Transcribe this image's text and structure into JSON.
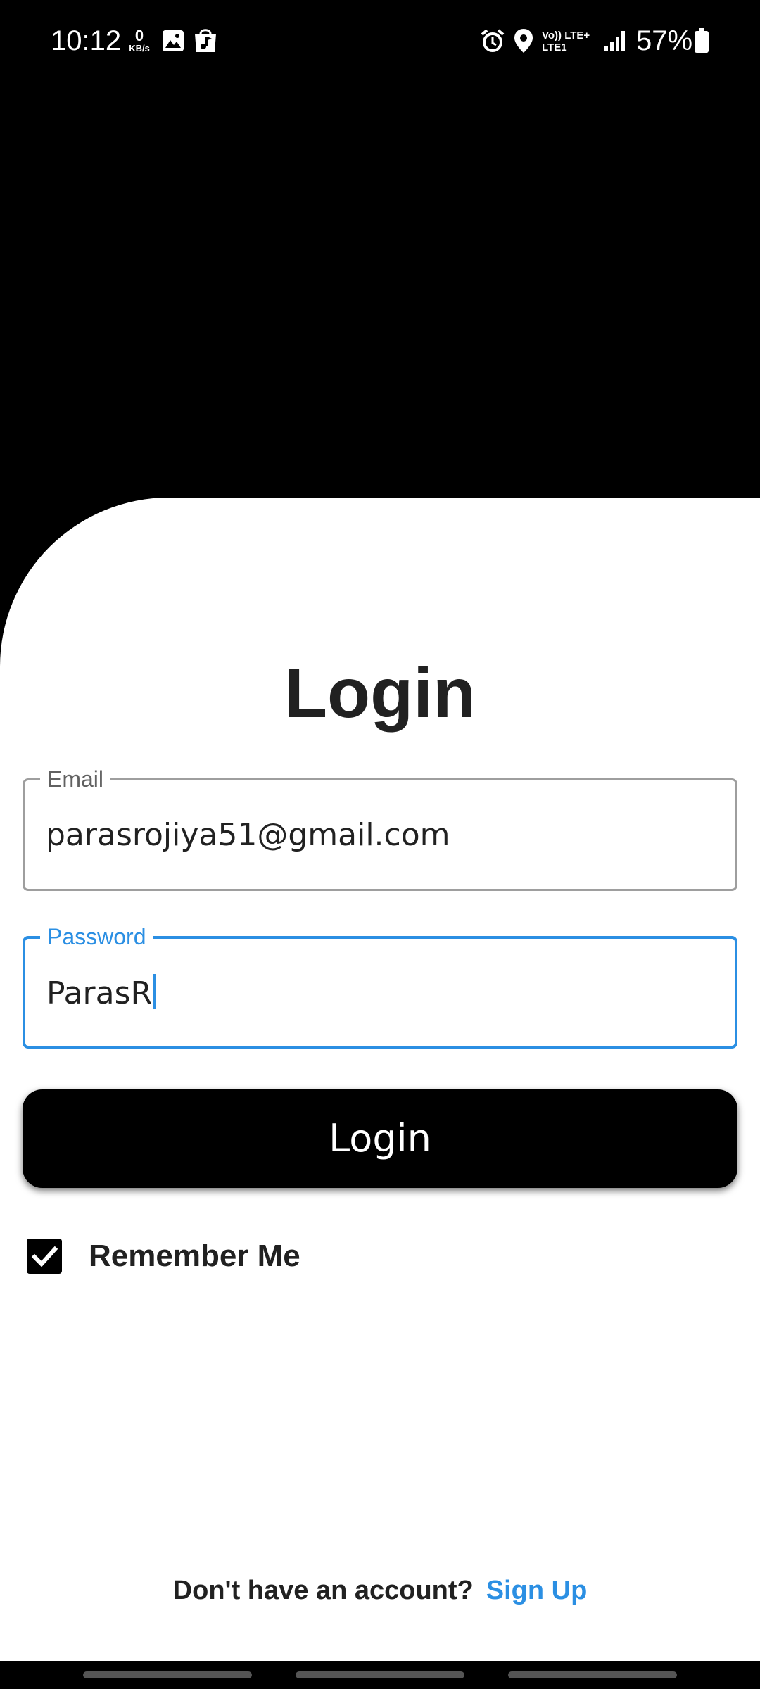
{
  "status_bar": {
    "time": "10:12",
    "data_rate_value": "0",
    "data_rate_unit": "KB/s",
    "network_top": "Vo)) LTE+",
    "network_bottom": "LTE1",
    "battery": "57%",
    "icons": [
      "image-icon",
      "app-notification-icon",
      "alarm-icon",
      "location-icon",
      "signal-icon",
      "battery-icon"
    ]
  },
  "login": {
    "title": "Login",
    "email": {
      "label": "Email",
      "value": "parasrojiya51@gmail.com"
    },
    "password": {
      "label": "Password",
      "value": "ParasR"
    },
    "button_label": "Login",
    "remember_me": {
      "label": "Remember Me",
      "checked": true
    },
    "footer_text": "Don't have an account?",
    "signup_label": "Sign Up"
  },
  "colors": {
    "accent": "#2b8fe3",
    "background_top": "#000000",
    "card": "#ffffff",
    "text": "#212121"
  }
}
